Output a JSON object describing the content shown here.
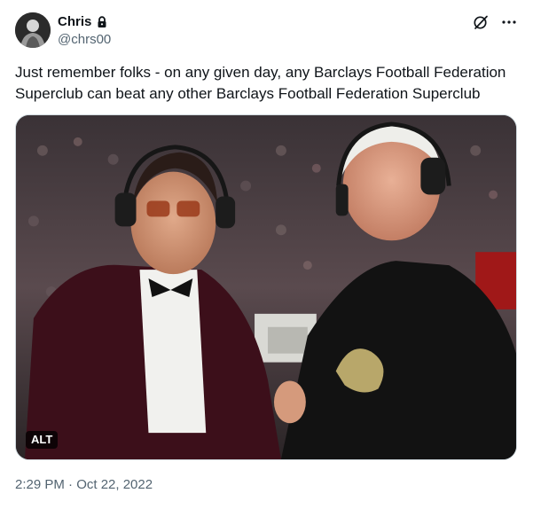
{
  "author": {
    "display_name": "Chris",
    "handle": "@chrs00",
    "protected": true
  },
  "tweet": {
    "text": "Just remember folks - on any given day, any Barclays Football Federation Superclub can beat any other Barclays Football Federation Superclub",
    "timestamp": "2:29 PM · Oct 22, 2022"
  },
  "media": {
    "alt_badge": "ALT"
  },
  "icons": {
    "avatar": "avatar",
    "lock": "lock-icon",
    "grok": "grok-icon",
    "more": "more-icon"
  },
  "colors": {
    "text": "#0f1419",
    "secondary": "#536471",
    "border": "#cfd9de"
  }
}
